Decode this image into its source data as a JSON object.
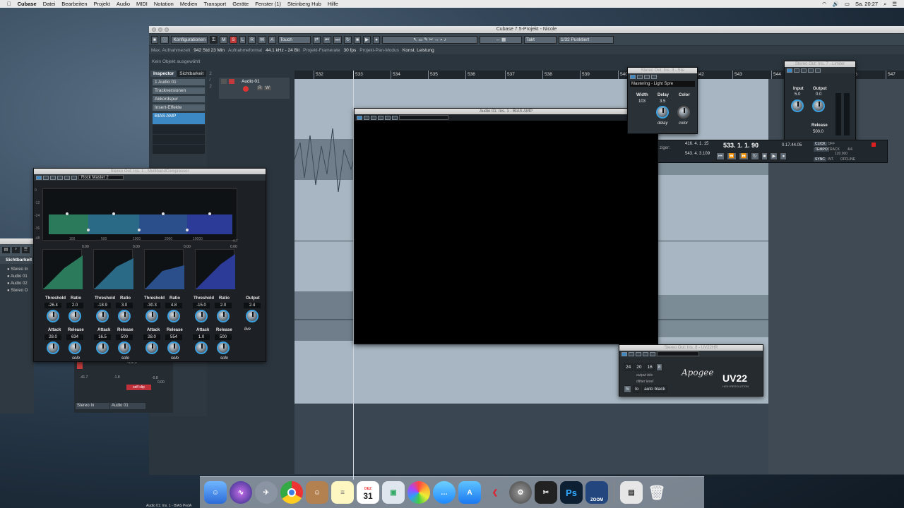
{
  "menubar": {
    "apple": "",
    "app": "Cubase",
    "items": [
      "Datei",
      "Bearbeiten",
      "Projekt",
      "Audio",
      "MIDI",
      "Notation",
      "Medien",
      "Transport",
      "Geräte",
      "Fenster (1)",
      "Steinberg Hub",
      "Hilfe"
    ],
    "clock": "Sa. 20:27"
  },
  "window": {
    "title": "Cubase 7.5-Projekt - Nicole"
  },
  "toolbar": {
    "config": "Konfigurationen",
    "mode_m": "M",
    "mode_s": "S",
    "mode_l": "L",
    "mode_r": "R",
    "mode_w": "W",
    "mode_a": "A",
    "automation": "Touch",
    "snap": "Takt",
    "quantize": "1/32  Punktiert"
  },
  "infobar": {
    "rec_time_label": "Max. Aufnahmezeit",
    "rec_time": "942 Std 23 Min",
    "rec_format_label": "Aufnahmeformat",
    "rec_format": "44.1 kHz - 24 Bit",
    "frame_label": "Projekt-Framerate",
    "frame": "30 fps",
    "pan_label": "Projekt-Pan-Modus",
    "pan": "Konst. Leistung"
  },
  "status": "Kein Objekt ausgewählt",
  "inspector": {
    "tab1": "Inspector",
    "tab2": "Sichtbarkeit",
    "count": "2 / 2",
    "track_no": "1",
    "track_name": "Audio 01",
    "rows": [
      "Trackversionen",
      "Akkordspur",
      "Insert-Effekte"
    ],
    "insert": "BIAS AMP"
  },
  "trackhead": {
    "name": "Audio 01",
    "r": "R",
    "w": "W"
  },
  "ruler": [
    "532",
    "533",
    "534",
    "535",
    "536",
    "537",
    "538",
    "539",
    "540",
    "541",
    "542",
    "543",
    "544",
    "545",
    "546",
    "547"
  ],
  "bias": {
    "title": "Audio 01: Ins. 1 - BIAS AMP"
  },
  "mbc": {
    "title": "Stereo Out: Ins. 1 - MultibandCompressor",
    "preset": "Rock Master 2",
    "yaxis": [
      "0",
      "-6",
      "-12",
      "-18",
      "-24",
      "-30",
      "-36",
      "-42",
      "-48"
    ],
    "freqs": [
      "20",
      "50",
      "100",
      "200",
      "500",
      "1000",
      "2000",
      "5000",
      "10000"
    ],
    "right_val": "-4.7",
    "gr_top": [
      "0.00",
      "0.00",
      "0.00",
      "0.00"
    ],
    "bands": [
      {
        "threshold": "-26.4",
        "ratio": "2.0",
        "attack": "28.0",
        "release": "634"
      },
      {
        "threshold": "-18.9",
        "ratio": "3.0",
        "attack": "16.5",
        "release": "500"
      },
      {
        "threshold": "-30.3",
        "ratio": "4.8",
        "attack": "28.0",
        "release": "554"
      },
      {
        "threshold": "-15.0",
        "ratio": "2.0",
        "attack": "1.0",
        "release": "500"
      }
    ],
    "output_label": "Output",
    "output": "2.4",
    "threshold_label": "Threshold",
    "ratio_label": "Ratio",
    "attack_label": "Attack",
    "release_label": "Release",
    "solo": "solo",
    "live": "live"
  },
  "width_plugin": {
    "title": "Stereo Out: Ins. 3 - Ste",
    "preset": "Mastering - Light Spre",
    "width_label": "Width",
    "delay_label": "Delay",
    "color_label": "Color",
    "width": "103",
    "delay": "3.5",
    "delay2": "delay",
    "color2": "color"
  },
  "limiter": {
    "title": "Stereo Out: Ins. 7 - Limiter",
    "input_label": "Input",
    "output_label": "Output",
    "input": "5.0",
    "output": "0.0",
    "release_label": "Release",
    "release": "500.0"
  },
  "transport": {
    "pos1": "416. 4. 1. 15",
    "pos2": "543. 4. 3.109",
    "main": "533. 1. 1. 90",
    "time": "0.17.44.05",
    "click": "CLICK",
    "click_val": "OFF",
    "tempo": "TEMPO",
    "tempo_mode": "TRACK",
    "sig": "4/4",
    "bpm": "120.000",
    "sync": "SYNC",
    "int": "INT.",
    "offline": "OFFLINE",
    "track_label": "ziger:"
  },
  "uv22": {
    "title": "Stereo Out: Ins. 8 - UV22HR",
    "bits": [
      "24",
      "20",
      "16",
      "8"
    ],
    "output_bits": "output bits",
    "dither": "dither level",
    "hi": "hi",
    "lo": "lo",
    "auto_black": "auto black",
    "logo": "UV22",
    "sub": "HIGH RESOLUTION",
    "sign": "Apogee"
  },
  "sicht": {
    "title": "Sichtbarkeit",
    "items": [
      "Stereo In",
      "Audio 01",
      "Audio 02",
      "Stereo O"
    ]
  },
  "mixer": {
    "val1": "-29.3",
    "val2": "-41.7",
    "val3": "-1.8",
    "val4": "-0.8",
    "val5": "0.00",
    "stereo_in": "Stereo In",
    "audio01": "Audio 01",
    "self_clip": "self clip"
  },
  "bottom": {
    "label": "Audio 01: Ins. 1 - BIAS PedA"
  },
  "dock": {
    "cal_month": "DEZ",
    "cal_day": "31",
    "ps": "Ps",
    "zoom": "ZOOM"
  }
}
